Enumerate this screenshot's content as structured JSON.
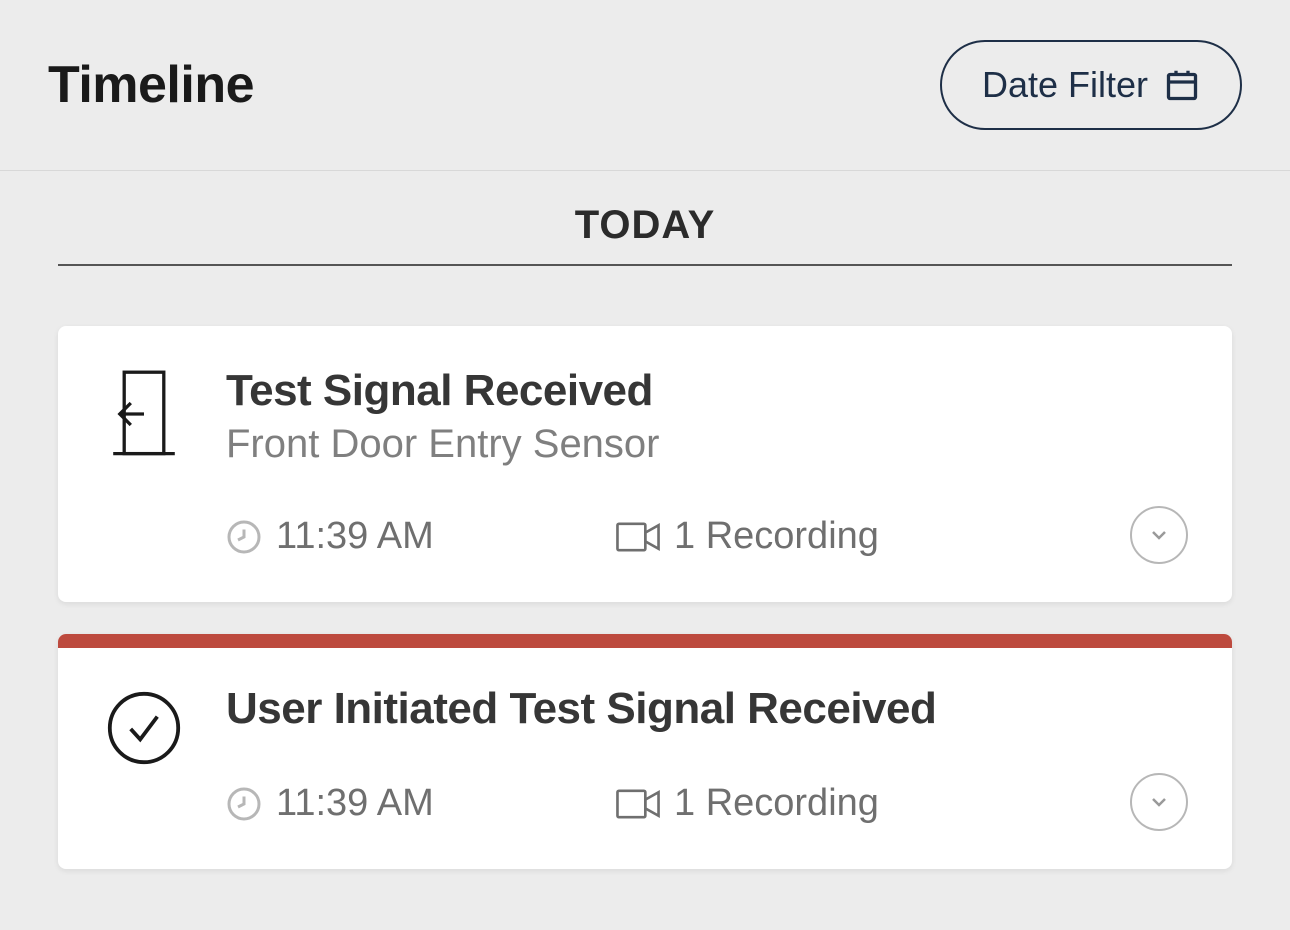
{
  "header": {
    "title": "Timeline",
    "dateFilterLabel": "Date Filter"
  },
  "sectionHeading": "TODAY",
  "events": [
    {
      "iconType": "door",
      "title": "Test Signal Received",
      "subtitle": "Front Door Entry Sensor",
      "time": "11:39 AM",
      "recordingsLabel": "1 Recording",
      "accent": false
    },
    {
      "iconType": "check",
      "title": "User Initiated Test Signal Received",
      "subtitle": "",
      "time": "11:39 AM",
      "recordingsLabel": "1 Recording",
      "accent": true
    }
  ]
}
